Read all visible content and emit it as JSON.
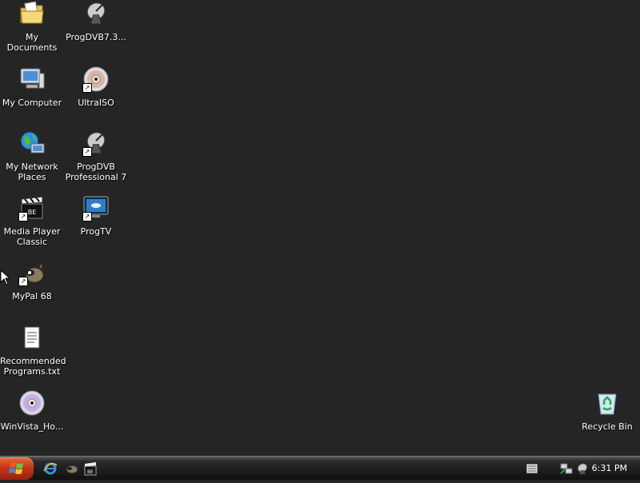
{
  "desktop": {
    "icons": [
      {
        "label": "My Documents"
      },
      {
        "label": "My Computer"
      },
      {
        "label": "My Network\nPlaces"
      },
      {
        "label": "Media Player\nClassic"
      },
      {
        "label": "MyPal 68"
      },
      {
        "label": "Recommended\nPrograms.txt"
      },
      {
        "label": "WinVista_Ho..."
      },
      {
        "label": "ProgDVB7.3..."
      },
      {
        "label": "UltraISO"
      },
      {
        "label": "ProgDVB\nProfessional 7"
      },
      {
        "label": "ProgTV"
      },
      {
        "label": "Recycle Bin"
      }
    ]
  },
  "taskbar": {
    "clock": "6:31 PM"
  },
  "colors": {
    "desktop_bg": "#252525",
    "start_button": "#c2361a"
  }
}
